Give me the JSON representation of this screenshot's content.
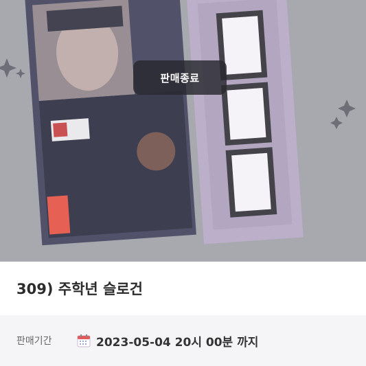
{
  "product": {
    "status_badge": "판매종료",
    "title": "309) 주학년 슬로건",
    "sale_period_label": "판매기간",
    "sale_period_value": "2023-05-04 20시 00분 까지",
    "image_alt": "slogan photo"
  },
  "icons": {
    "calendar": "calendar-icon"
  },
  "colors": {
    "hero_overlay": "#9a9aa1",
    "slogan_bg": "#a89ab8",
    "badge_bg": "#28282e",
    "info_bg": "#f5f5f7"
  }
}
